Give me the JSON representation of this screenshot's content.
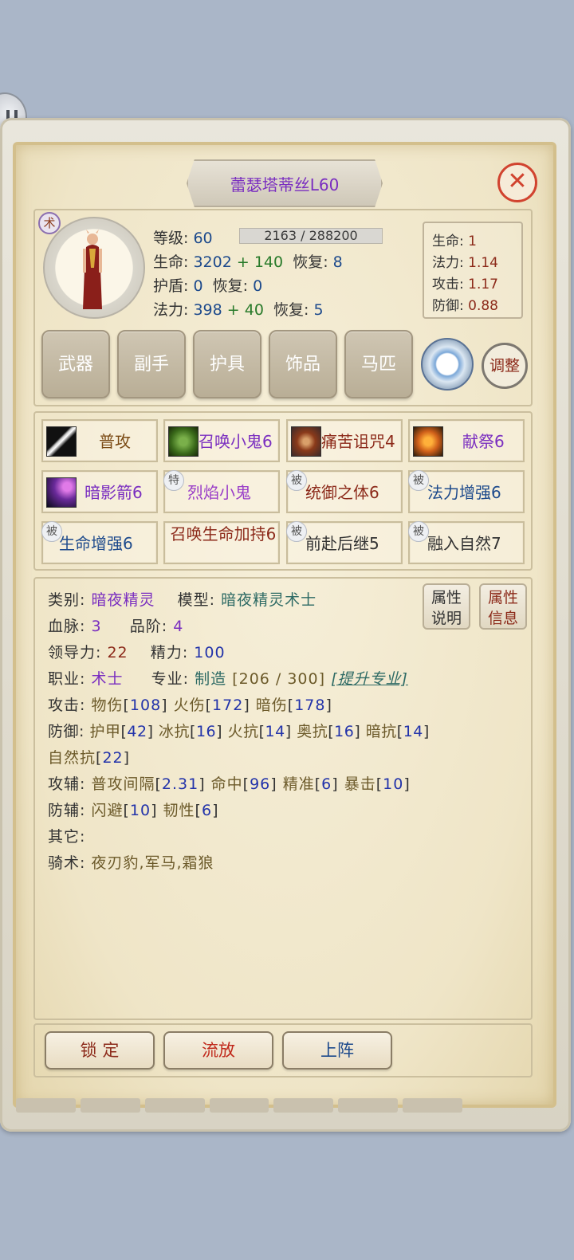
{
  "title": "蕾瑟塔蒂丝L60",
  "close_symbol": "✕",
  "class_badge": "术",
  "stats": {
    "level_label": "等级:",
    "level_value": "60",
    "xp_text": "2163 / 288200",
    "hp_label": "生命:",
    "hp_base": "3202",
    "hp_bonus": "+ 140",
    "hp_regen_label": "恢复:",
    "hp_regen": "8",
    "shield_label": "护盾:",
    "shield_value": "0",
    "shield_regen_label": "恢复:",
    "shield_regen": "0",
    "mp_label": "法力:",
    "mp_base": "398",
    "mp_bonus": "+ 40",
    "mp_regen_label": "恢复:",
    "mp_regen": "5"
  },
  "multipliers": [
    {
      "label": "生命:",
      "value": "1"
    },
    {
      "label": "法力:",
      "value": "1.14"
    },
    {
      "label": "攻击:",
      "value": "1.17"
    },
    {
      "label": "防御:",
      "value": "0.88"
    }
  ],
  "equip_tabs": [
    "武器",
    "副手",
    "护具",
    "饰品",
    "马匹"
  ],
  "adjust_label": "调整",
  "skills": [
    {
      "name": "普攻",
      "tag": "",
      "icon": "sword-icon",
      "color": "#7a4a14"
    },
    {
      "name": "召唤小鬼6",
      "tag": "",
      "icon": "imp-icon",
      "color": "#7a2ec0"
    },
    {
      "name": "痛苦诅咒4",
      "tag": "",
      "icon": "curse-icon",
      "color": "#8c2a1a"
    },
    {
      "name": "献祭6",
      "tag": "",
      "icon": "immolate-icon",
      "color": "#7a2ec0"
    },
    {
      "name": "暗影箭6",
      "tag": "",
      "icon": "shadowbolt-icon",
      "color": "#7a2ec0"
    },
    {
      "name": "烈焰小鬼",
      "tag": "特",
      "icon": "",
      "color": "#9a3ec8"
    },
    {
      "name": "统御之体6",
      "tag": "被",
      "icon": "",
      "color": "#8c2a1a"
    },
    {
      "name": "法力增强6",
      "tag": "被",
      "icon": "",
      "color": "#1d4a8c"
    },
    {
      "name": "生命增强6",
      "tag": "被",
      "icon": "",
      "color": "#1d4a8c"
    },
    {
      "name": "召唤生命加持6",
      "tag": "",
      "icon": "",
      "color": "#8c2a1a"
    },
    {
      "name": "前赴后继5",
      "tag": "被",
      "icon": "",
      "color": "#333333"
    },
    {
      "name": "融入自然7",
      "tag": "被",
      "icon": "",
      "color": "#333333"
    }
  ],
  "info": {
    "category_label": "类别:",
    "category_value": "暗夜精灵",
    "model_label": "模型:",
    "model_value": "暗夜精灵术士",
    "bloodline_label": "血脉:",
    "bloodline_value": "3",
    "grade_label": "品阶:",
    "grade_value": "4",
    "leadership_label": "领导力:",
    "leadership_value": "22",
    "energy_label": "精力:",
    "energy_value": "100",
    "job_label": "职业:",
    "job_value": "术士",
    "profession_label": "专业:",
    "profession_value": "制造",
    "profession_progress": "[206 / 300]",
    "upgrade_link": "[提升专业]",
    "attack_label": "攻击:",
    "attack_values": [
      {
        "name": "物伤",
        "value": "108"
      },
      {
        "name": "火伤",
        "value": "172"
      },
      {
        "name": "暗伤",
        "value": "178"
      }
    ],
    "defense_label": "防御:",
    "defense_values": [
      {
        "name": "护甲",
        "value": "42"
      },
      {
        "name": "冰抗",
        "value": "16"
      },
      {
        "name": "火抗",
        "value": "14"
      },
      {
        "name": "奥抗",
        "value": "16"
      },
      {
        "name": "暗抗",
        "value": "14"
      },
      {
        "name": "自然抗",
        "value": "22"
      }
    ],
    "atk_assist_label": "攻辅:",
    "atk_assist_values": [
      {
        "name": "普攻间隔",
        "value": "2.31"
      },
      {
        "name": "命中",
        "value": "96"
      },
      {
        "name": "精准",
        "value": "6"
      },
      {
        "name": "暴击",
        "value": "10"
      }
    ],
    "def_assist_label": "防辅:",
    "def_assist_values": [
      {
        "name": "闪避",
        "value": "10"
      },
      {
        "name": "韧性",
        "value": "6"
      }
    ],
    "other_label": "其它:",
    "riding_label": "骑术:",
    "riding_value": "夜刃豹,军马,霜狼",
    "btn_attr_desc": [
      "属性",
      "说明"
    ],
    "btn_attr_info": [
      "属性",
      "信息"
    ]
  },
  "bottom_buttons": {
    "lock": "锁 定",
    "exile": "流放",
    "deploy": "上阵"
  }
}
